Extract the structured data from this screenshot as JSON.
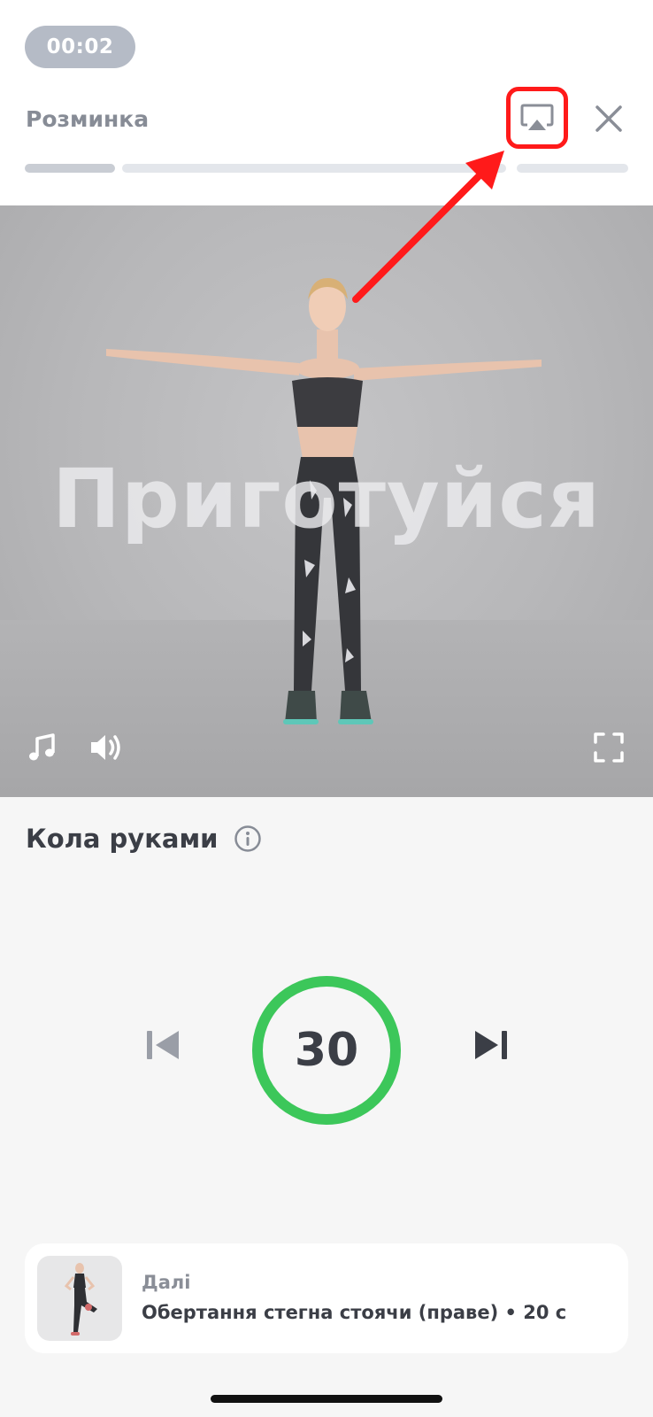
{
  "header": {
    "timer": "00:02",
    "section_title": "Розминка",
    "progress_segments": 3,
    "active_segment": 1
  },
  "icons": {
    "airplay": "airplay-icon",
    "close": "close-icon",
    "music": "music-note-icon",
    "volume": "volume-icon",
    "fullscreen": "fullscreen-icon",
    "info": "info-icon",
    "previous": "skip-previous-icon",
    "next": "skip-next-icon"
  },
  "video": {
    "overlay_text": "Приготуйся"
  },
  "exercise": {
    "name": "Кола руками",
    "countdown": "30",
    "countdown_progress": 1.0
  },
  "up_next": {
    "label": "Далі",
    "title": "Обертання стегна стоячи (праве) • 20 с"
  },
  "colors": {
    "accent_green": "#3cc75a",
    "highlight_red": "#ff1a1a",
    "timer_pill": "#b5bbc6",
    "text_dark": "#3b3e46",
    "text_muted": "#878c96"
  }
}
